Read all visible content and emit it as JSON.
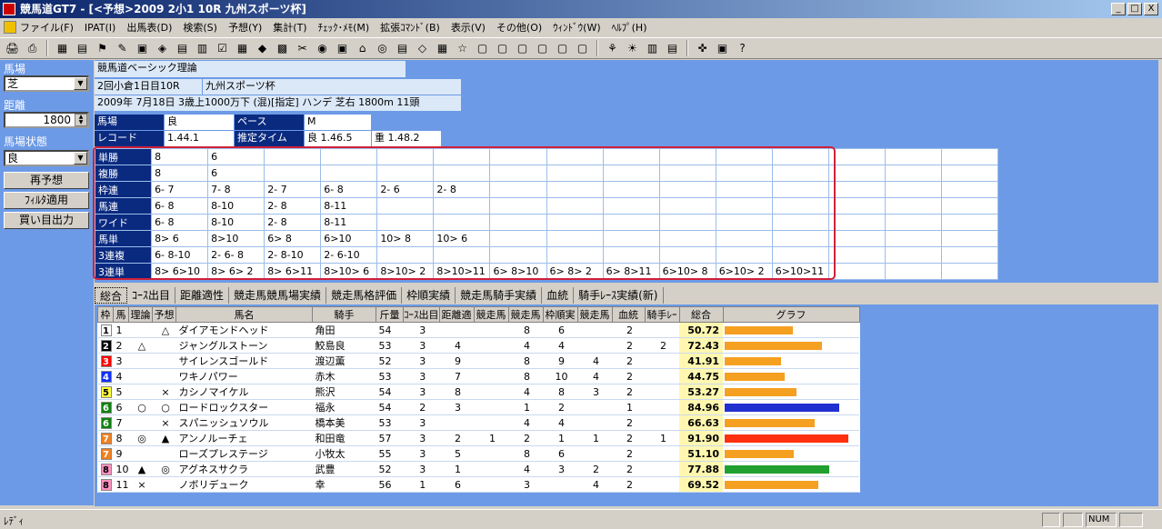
{
  "window": {
    "title": "競馬道GT7 - [<予想>2009 2小1 10R 九州スポーツ杯]",
    "btn_min": "_",
    "btn_max": "□",
    "btn_close": "X"
  },
  "menu": [
    "ファイル(F)",
    "IPAT(I)",
    "出馬表(D)",
    "検索(S)",
    "予想(Y)",
    "集計(T)",
    "ﾁｪｯｸ･ﾒﾓ(M)",
    "拡張ｺﾏﾝﾄﾞ(B)",
    "表示(V)",
    "その他(O)",
    "ｳｨﾝﾄﾞｳ(W)",
    "ﾍﾙﾌﾟ(H)"
  ],
  "left": {
    "surface_label": "馬場",
    "surface_value": "芝",
    "distance_label": "距離",
    "distance_value": "1800",
    "condition_label": "馬場状態",
    "condition_value": "良",
    "btn_repredict": "再予想",
    "btn_filter": "ﾌｨﾙﾀ適用",
    "btn_export": "買い目出力"
  },
  "info": {
    "theory": "競馬道ベーシック理論",
    "race_id": "2回小倉1日目10R",
    "race_name": "九州スポーツ杯",
    "race_detail": "2009年 7月18日 3歳上1000万下 (混)[指定] ハンデ 芝右 1800m 11頭",
    "baba_label": "馬場",
    "baba_value": "良",
    "pace_label": "ペース",
    "pace_value": "M",
    "record_label": "レコード",
    "record_value": "1.44.1",
    "est_label": "推定タイム",
    "est_ryo": "良 1.46.5",
    "est_omo": "重 1.48.2"
  },
  "bets": [
    {
      "type": "単勝",
      "values": [
        "8",
        "6"
      ]
    },
    {
      "type": "複勝",
      "values": [
        "8",
        "6"
      ]
    },
    {
      "type": "枠連",
      "values": [
        "6- 7",
        "7- 8",
        "2- 7",
        "6- 8",
        "2- 6",
        "2- 8"
      ]
    },
    {
      "type": "馬連",
      "values": [
        "6- 8",
        "8-10",
        "2- 8",
        "8-11"
      ]
    },
    {
      "type": "ワイド",
      "values": [
        "6- 8",
        "8-10",
        "2- 8",
        "8-11"
      ]
    },
    {
      "type": "馬単",
      "values": [
        "8> 6",
        "8>10",
        "6> 8",
        "6>10",
        "10> 8",
        "10> 6"
      ]
    },
    {
      "type": "3連複",
      "values": [
        "6- 8-10",
        "2- 6- 8",
        "2- 8-10",
        "2- 6-10"
      ]
    },
    {
      "type": "3連単",
      "values": [
        "8> 6>10",
        "8> 6> 2",
        "8> 6>11",
        "8>10> 6",
        "8>10> 2",
        "8>10>11",
        "6> 8>10",
        "6> 8> 2",
        "6> 8>11",
        "6>10> 8",
        "6>10> 2",
        "6>10>11"
      ]
    }
  ],
  "tabs": [
    "総合",
    "ｺｰｽ出目",
    "距離適性",
    "競走馬競馬場実績",
    "競走馬格評価",
    "枠順実績",
    "競走馬騎手実績",
    "血統",
    "騎手ﾚｰｽ実績(新)"
  ],
  "columns": [
    "枠",
    "馬",
    "理論",
    "予想",
    "馬名",
    "騎手",
    "斤量",
    "ｺｰｽ出目",
    "距離適",
    "競走馬",
    "競走馬",
    "枠順実",
    "競走馬",
    "血統",
    "騎手ﾚｰ",
    "総合",
    "グラフ"
  ],
  "horses": [
    {
      "waku": "1",
      "uma": "1",
      "riron": "",
      "yoso": "△",
      "name": "ダイアモンドヘッド",
      "jockey": "角田",
      "kin": "54",
      "c1": "3",
      "c2": "",
      "c3": "",
      "c4": "8",
      "c5": "6",
      "c6": "",
      "c7": "2",
      "c8": "",
      "score": "50.72",
      "wcolor": "#ffffff",
      "wtext": "#000000",
      "barcolor": "#f5a020",
      "bar": 0.5072
    },
    {
      "waku": "2",
      "uma": "2",
      "riron": "△",
      "yoso": "",
      "name": "ジャングルストーン",
      "jockey": "鮫島良",
      "kin": "53",
      "c1": "3",
      "c2": "4",
      "c3": "",
      "c4": "4",
      "c5": "4",
      "c6": "",
      "c7": "2",
      "c8": "2",
      "score": "72.43",
      "wcolor": "#000000",
      "wtext": "#ffffff",
      "barcolor": "#f5a020",
      "bar": 0.7243
    },
    {
      "waku": "3",
      "uma": "3",
      "riron": "",
      "yoso": "",
      "name": "サイレンスゴールド",
      "jockey": "渡辺薫",
      "kin": "52",
      "c1": "3",
      "c2": "9",
      "c3": "",
      "c4": "8",
      "c5": "9",
      "c6": "4",
      "c7": "2",
      "c8": "",
      "score": "41.91",
      "wcolor": "#ff0000",
      "wtext": "#ffffff",
      "barcolor": "#f5a020",
      "bar": 0.4191
    },
    {
      "waku": "4",
      "uma": "4",
      "riron": "",
      "yoso": "",
      "name": "ワキノパワー",
      "jockey": "赤木",
      "kin": "53",
      "c1": "3",
      "c2": "7",
      "c3": "",
      "c4": "8",
      "c5": "10",
      "c6": "4",
      "c7": "2",
      "c8": "",
      "score": "44.75",
      "wcolor": "#1030ff",
      "wtext": "#ffffff",
      "barcolor": "#f5a020",
      "bar": 0.4475
    },
    {
      "waku": "5",
      "uma": "5",
      "riron": "",
      "yoso": "×",
      "name": "カシノマイケル",
      "jockey": "熊沢",
      "kin": "54",
      "c1": "3",
      "c2": "8",
      "c3": "",
      "c4": "4",
      "c5": "8",
      "c6": "3",
      "c7": "2",
      "c8": "",
      "score": "53.27",
      "wcolor": "#ffff40",
      "wtext": "#000000",
      "barcolor": "#f5a020",
      "bar": 0.5327
    },
    {
      "waku": "6",
      "uma": "6",
      "riron": "○",
      "yoso": "○",
      "name": "ロードロックスター",
      "jockey": "福永",
      "kin": "54",
      "c1": "2",
      "c2": "3",
      "c3": "",
      "c4": "1",
      "c5": "2",
      "c6": "",
      "c7": "1",
      "c8": "",
      "score": "84.96",
      "wcolor": "#108010",
      "wtext": "#ffffff",
      "barcolor": "#2030d0",
      "bar": 0.8496
    },
    {
      "waku": "6",
      "uma": "7",
      "riron": "",
      "yoso": "×",
      "name": "スパニッシュソウル",
      "jockey": "橋本美",
      "kin": "53",
      "c1": "3",
      "c2": "",
      "c3": "",
      "c4": "4",
      "c5": "4",
      "c6": "",
      "c7": "2",
      "c8": "",
      "score": "66.63",
      "wcolor": "#108010",
      "wtext": "#ffffff",
      "barcolor": "#f5a020",
      "bar": 0.6663
    },
    {
      "waku": "7",
      "uma": "8",
      "riron": "◎",
      "yoso": "▲",
      "name": "アンノルーチェ",
      "jockey": "和田竜",
      "kin": "57",
      "c1": "3",
      "c2": "2",
      "c3": "1",
      "c4": "2",
      "c5": "1",
      "c6": "1",
      "c7": "2",
      "c8": "1",
      "score": "91.90",
      "wcolor": "#f08020",
      "wtext": "#ffffff",
      "barcolor": "#ff3010",
      "bar": 0.919
    },
    {
      "waku": "7",
      "uma": "9",
      "riron": "",
      "yoso": "",
      "name": "ローズプレステージ",
      "jockey": "小牧太",
      "kin": "55",
      "c1": "3",
      "c2": "5",
      "c3": "",
      "c4": "8",
      "c5": "6",
      "c6": "",
      "c7": "2",
      "c8": "",
      "score": "51.10",
      "wcolor": "#f08020",
      "wtext": "#ffffff",
      "barcolor": "#f5a020",
      "bar": 0.511
    },
    {
      "waku": "8",
      "uma": "10",
      "riron": "▲",
      "yoso": "◎",
      "name": "アグネスサクラ",
      "jockey": "武豊",
      "kin": "52",
      "c1": "3",
      "c2": "1",
      "c3": "",
      "c4": "4",
      "c5": "3",
      "c6": "2",
      "c7": "2",
      "c8": "",
      "score": "77.88",
      "wcolor": "#ff90c0",
      "wtext": "#000000",
      "barcolor": "#20a030",
      "bar": 0.7788
    },
    {
      "waku": "8",
      "uma": "11",
      "riron": "×",
      "yoso": "",
      "name": "ノボリデューク",
      "jockey": "幸",
      "kin": "56",
      "c1": "1",
      "c2": "6",
      "c3": "",
      "c4": "3",
      "c5": "",
      "c6": "4",
      "c7": "2",
      "c8": "",
      "score": "69.52",
      "wcolor": "#ff90c0",
      "wtext": "#000000",
      "barcolor": "#f5a020",
      "bar": 0.6952
    }
  ],
  "status": {
    "text": "ﾚﾃﾞｨ",
    "num": "NUM"
  }
}
